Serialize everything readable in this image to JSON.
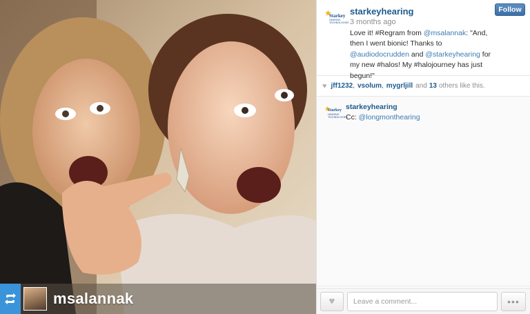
{
  "photo": {
    "alt": "Two women making excited faces, one giving a thumbs up",
    "regram_icon": "retweet-arrows-icon",
    "regram_username": "msalannak"
  },
  "post": {
    "author": "starkeyhearing",
    "logo": {
      "brand": "Starkey",
      "sub": "HEARING TECHNOLOGIES",
      "icon": "starkey-star-logo-icon"
    },
    "follow_label": "Follow",
    "time": "3 months ago",
    "caption": {
      "t1": "Love it! #Regram from ",
      "m1": "@msalannak",
      "t2": ": \"And, then I went bionic! Thanks to ",
      "m2": "@audiodocrudden",
      "t3": " and ",
      "m3": "@starkeyhearing",
      "t4": " for my new #halos! My #halojourney has just begun!\""
    }
  },
  "likes": {
    "icon": "heart-icon",
    "users": [
      "jff1232",
      "vsolum",
      "mygrljill"
    ],
    "and_label": "and",
    "others_count": "13",
    "suffix": "others like this."
  },
  "comments": [
    {
      "user": "starkeyhearing",
      "prefix": "Cc: ",
      "mention": "@longmonthearing"
    }
  ],
  "actions": {
    "like_icon": "heart-icon",
    "comment_placeholder": "Leave a comment...",
    "more_icon": "ellipsis-icon",
    "more_label": "•••"
  },
  "colors": {
    "link": "#1e5a8d",
    "follow_button": "#3d6fa4",
    "regram_blue": "#3b94d9"
  }
}
